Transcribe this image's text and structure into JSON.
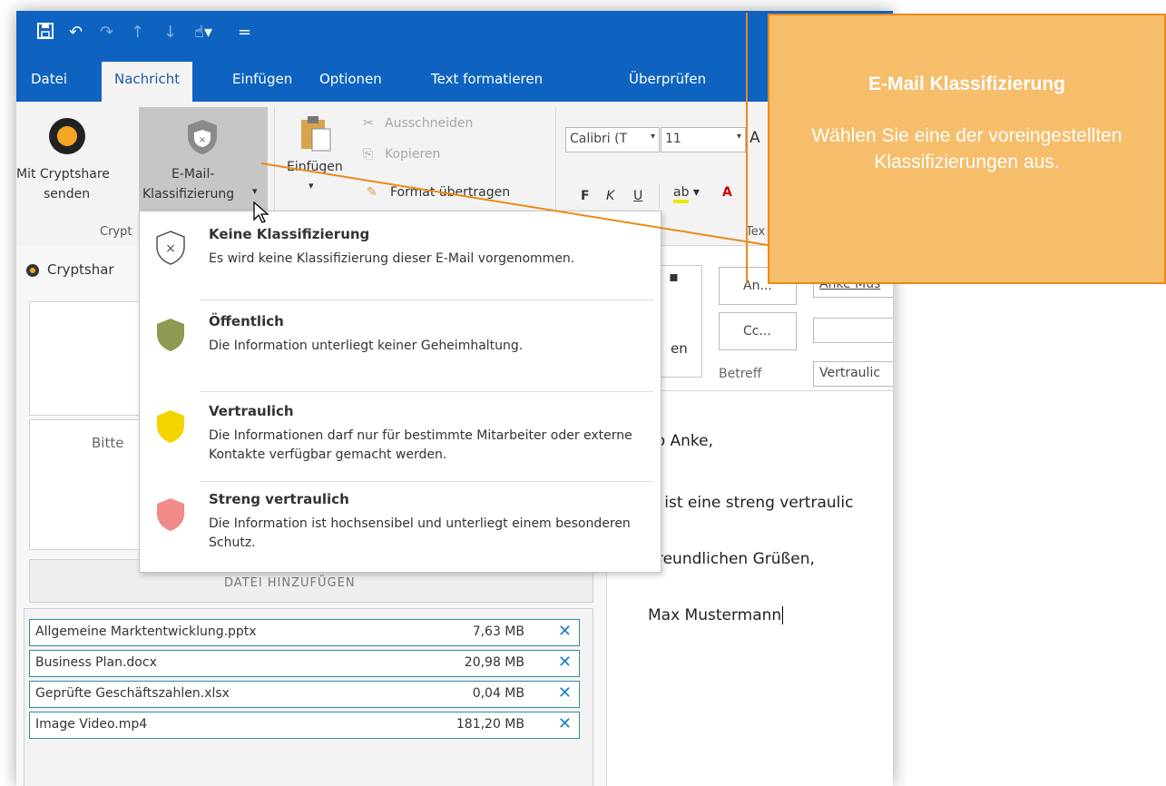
{
  "quick_access": [
    "save-icon",
    "undo-icon",
    "redo-icon",
    "up-icon",
    "down-icon",
    "touch-icon",
    "customize-icon"
  ],
  "tabs": [
    "Datei",
    "Nachricht",
    "Einfügen",
    "Optionen",
    "Text formatieren",
    "Überprüfen"
  ],
  "active_tab": "Nachricht",
  "ribbon": {
    "cryptshare_line1": "Mit Cryptshare",
    "cryptshare_line2": "senden",
    "group_cryptshare": "Crypt",
    "classification_line1": "E-Mail-",
    "classification_line2": "Klassifizierung",
    "paste_label": "Einfügen",
    "cut": "Ausschneiden",
    "copy": "Kopieren",
    "format_painter": "Format übertragen",
    "font_name": "Calibri (T",
    "font_size": "11",
    "bold": "F",
    "italic": "K",
    "underline": "U",
    "group_text": "Tex"
  },
  "left_pane": {
    "header": "Cryptshar",
    "prompt_text": "Bitte",
    "add_file_button": "DATEI HINZUFÜGEN",
    "files": [
      {
        "name": "Allgemeine Marktentwicklung.pptx",
        "size": "7,63 MB"
      },
      {
        "name": "Business Plan.docx",
        "size": "20,98 MB"
      },
      {
        "name": "Geprüfte Geschäftszahlen.xlsx",
        "size": "0,04 MB"
      },
      {
        "name": "Image Video.mp4",
        "size": "181,20 MB"
      }
    ]
  },
  "compose": {
    "send_label": "en",
    "to_button": "An...",
    "to_value": "Anke Mus",
    "cc_button": "Cc...",
    "subject_label": "Betreff",
    "subject_value": "Vertraulic",
    "greeting": "lo Anke,",
    "line2": "s ist eine streng vertraulic",
    "closing": "freundlichen Grüßen,",
    "signature": "Max Mustermann"
  },
  "classification_menu": [
    {
      "title": "Keine Klassifizierung",
      "description": "Es wird keine Klassifizierung dieser E-Mail vorgenommen.",
      "color": "#ffffff"
    },
    {
      "title": "Öffentlich",
      "description": "Die Information unterliegt keiner Geheimhaltung.",
      "color": "#8c9a52"
    },
    {
      "title": "Vertraulich",
      "description": "Die Informationen darf nur für bestimmte Mitarbeiter oder externe Kontakte verfügbar gemacht werden.",
      "color": "#f2d500"
    },
    {
      "title": "Streng vertraulich",
      "description": "Die Information ist hochsensibel und unterliegt einem besonderen Schutz.",
      "color": "#f28a8a"
    }
  ],
  "callout": {
    "title": "E-Mail Klassifizierung",
    "text": "Wählen Sie eine der voreingestellten Klassifizierungen aus."
  },
  "colors": {
    "ribbon_blue": "#0f63c0",
    "callout_fill": "#f6bd6b",
    "callout_border": "#e88a1a",
    "file_border": "#2d8fa0"
  }
}
